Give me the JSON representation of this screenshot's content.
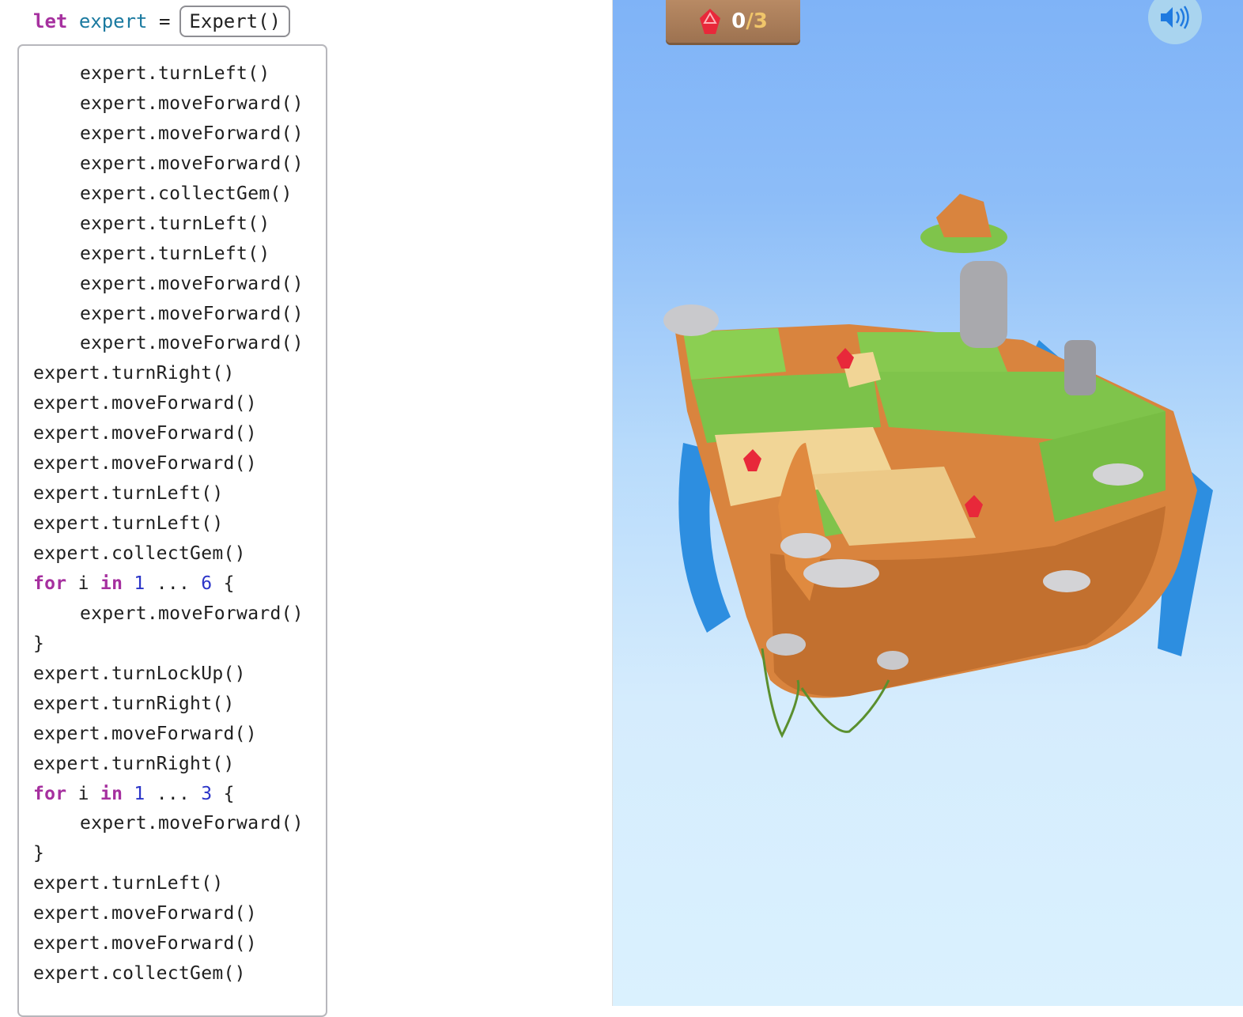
{
  "declaration": {
    "keyword": "let",
    "name": "expert",
    "equals": "=",
    "type_value": "Expert()"
  },
  "code": {
    "lines": [
      {
        "indent": true,
        "text": "expert.turnLeft()"
      },
      {
        "indent": true,
        "text": "expert.moveForward()"
      },
      {
        "indent": true,
        "text": "expert.moveForward()"
      },
      {
        "indent": true,
        "text": "expert.moveForward()"
      },
      {
        "indent": true,
        "text": "expert.collectGem()"
      },
      {
        "indent": true,
        "text": "expert.turnLeft()"
      },
      {
        "indent": true,
        "text": "expert.turnLeft()"
      },
      {
        "indent": true,
        "text": "expert.moveForward()"
      },
      {
        "indent": true,
        "text": "expert.moveForward()"
      },
      {
        "indent": true,
        "text": "expert.moveForward()"
      },
      {
        "indent": false,
        "text": "expert.turnRight()"
      },
      {
        "indent": false,
        "text": "expert.moveForward()"
      },
      {
        "indent": false,
        "text": "expert.moveForward()"
      },
      {
        "indent": false,
        "text": "expert.moveForward()"
      },
      {
        "indent": false,
        "text": "expert.turnLeft()"
      },
      {
        "indent": false,
        "text": "expert.turnLeft()"
      },
      {
        "indent": false,
        "text": "expert.collectGem()"
      },
      {
        "indent": false,
        "loop": true,
        "kw_for": "for",
        "var": "i",
        "kw_in": "in",
        "start": "1",
        "range": "...",
        "end": "6",
        "brace": "{"
      },
      {
        "indent": true,
        "text": "expert.moveForward()"
      },
      {
        "indent": false,
        "text": "}"
      },
      {
        "indent": false,
        "text": "expert.turnLockUp()"
      },
      {
        "indent": false,
        "text": "expert.turnRight()"
      },
      {
        "indent": false,
        "text": "expert.moveForward()"
      },
      {
        "indent": false,
        "text": "expert.turnRight()"
      },
      {
        "indent": false,
        "loop": true,
        "kw_for": "for",
        "var": "i",
        "kw_in": "in",
        "start": "1",
        "range": "...",
        "end": "3",
        "brace": "{"
      },
      {
        "indent": true,
        "text": "expert.moveForward()"
      },
      {
        "indent": false,
        "text": "}"
      },
      {
        "indent": false,
        "text": "expert.turnLeft()"
      },
      {
        "indent": false,
        "text": "expert.moveForward()"
      },
      {
        "indent": false,
        "text": "expert.moveForward()"
      },
      {
        "indent": false,
        "text": "expert.collectGem()"
      }
    ]
  },
  "game": {
    "score": {
      "collected": "0",
      "separator": "/",
      "total": "3",
      "icon": "gem-icon"
    },
    "sound_icon": "speaker-icon",
    "colors": {
      "keyword": "#a6309f",
      "identifier": "#1b7aa0",
      "number": "#2b34c8",
      "gem": "#e8283a",
      "grass": "#7cc24a",
      "dirt": "#d9843e"
    }
  }
}
